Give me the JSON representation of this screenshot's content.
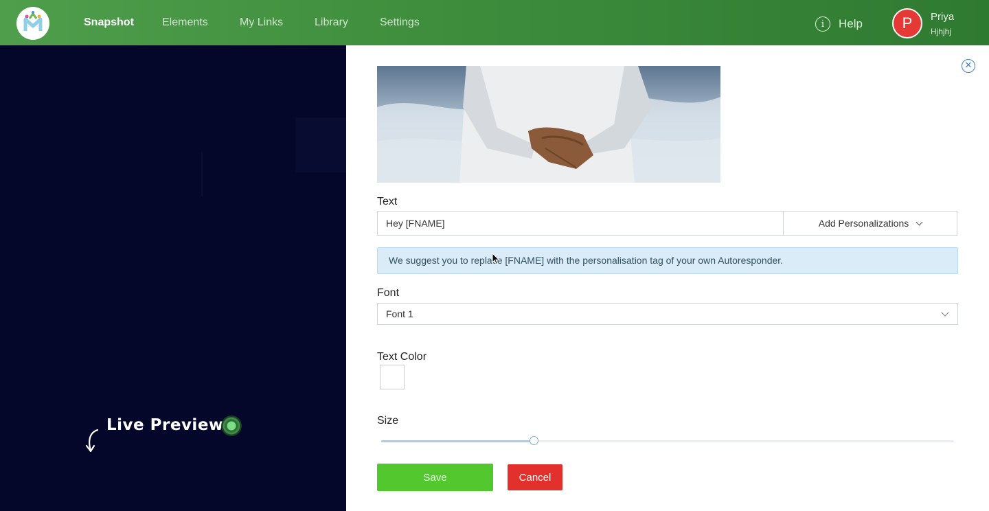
{
  "nav": {
    "items": [
      {
        "label": "Snapshot",
        "active": true
      },
      {
        "label": "Elements",
        "active": false
      },
      {
        "label": "My Links",
        "active": false
      },
      {
        "label": "Library",
        "active": false
      },
      {
        "label": "Settings",
        "active": false
      }
    ],
    "help_label": "Help",
    "user": {
      "initial": "P",
      "name": "Priya",
      "subtitle": "Hjhjhj"
    }
  },
  "overlay": {
    "live_preview_label": "Live Preview"
  },
  "editor": {
    "close_symbol": "✕",
    "text_label": "Text",
    "text_value": "Hey [FNAME]",
    "personalize_label": "Add Personalizations",
    "alert_text": "We suggest you to replace [FNAME] with the personalisation tag of your own Autoresponder.",
    "font_label": "Font",
    "font_value": "Font 1",
    "color_label": "Text Color",
    "text_color": "#ffffff",
    "size_label": "Size",
    "size_fraction": 0.267,
    "save_label": "Save",
    "cancel_label": "Cancel"
  },
  "colors": {
    "nav_green": "#3f8f3e",
    "save_green": "#52c82e",
    "cancel_red": "#e2312d",
    "avatar_red": "#e53935",
    "alert_bg": "#d9ecf7"
  }
}
